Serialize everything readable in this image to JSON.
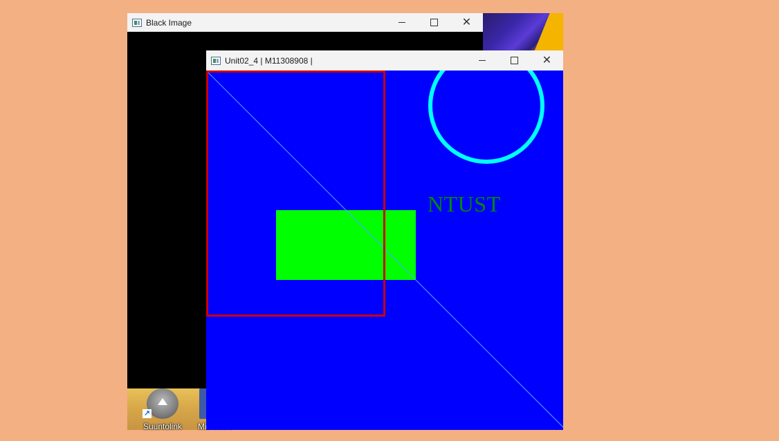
{
  "desktop": {
    "background_color": "#F3B083",
    "shortcuts": [
      {
        "label": "Suuntolink",
        "icon": "suuntolink-app-icon"
      },
      {
        "label": "Microsoft",
        "icon": "microsoft-app-icon"
      }
    ]
  },
  "windows": {
    "black_image": {
      "title": "Black Image",
      "icon": "opencv-window-icon",
      "controls": {
        "minimize": "minimize-icon",
        "maximize": "maximize-icon",
        "close": "close-icon"
      },
      "canvas_color": "#000000"
    },
    "unit02": {
      "title": "Unit02_4 | M11308908 |",
      "icon": "opencv-window-icon",
      "controls": {
        "minimize": "minimize-icon",
        "maximize": "maximize-icon",
        "close": "close-icon"
      },
      "canvas": {
        "background_color": "#0000FF",
        "text": {
          "content": "NTUST",
          "color": "#008A00"
        },
        "diagonal_line_color": "#4FA8FF",
        "red_rectangle_color": "#CC0000",
        "green_rectangle_color": "#00FF00",
        "circle_color": "#00FFFF"
      }
    }
  }
}
